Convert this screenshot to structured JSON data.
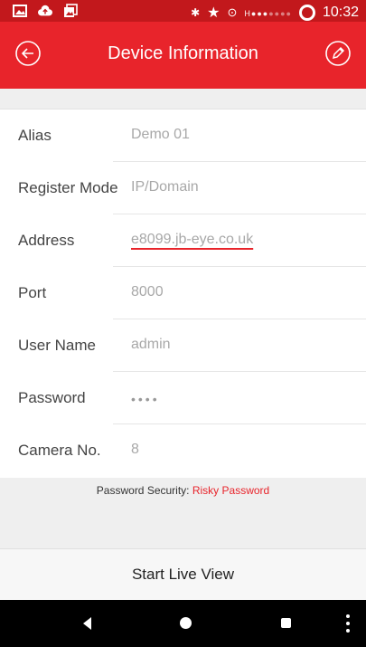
{
  "status_bar": {
    "time": "10:32",
    "icons": [
      "image-icon",
      "cloud-upload-icon",
      "gallery-icon",
      "bluetooth-icon",
      "star-icon",
      "alarm-icon",
      "signal-icon",
      "sync-ring-icon"
    ]
  },
  "header": {
    "title": "Device Information",
    "back_icon": "back-arrow-icon",
    "edit_icon": "pencil-icon"
  },
  "form": {
    "rows": [
      {
        "label": "Alias",
        "value": "Demo 01"
      },
      {
        "label": "Register Mode",
        "value": "IP/Domain"
      },
      {
        "label": "Address",
        "value": "e8099.jb-eye.co.uk"
      },
      {
        "label": "Port",
        "value": "8000"
      },
      {
        "label": "User Name",
        "value": "admin"
      },
      {
        "label": "Password",
        "value": "••••"
      },
      {
        "label": "Camera No.",
        "value": "8"
      }
    ]
  },
  "password_security": {
    "label": "Password Security:",
    "status": "Risky Password",
    "status_color": "#e8242b"
  },
  "start_live_view": "Start Live View",
  "colors": {
    "accent": "#e8242b",
    "status_bar": "#c2181c"
  }
}
